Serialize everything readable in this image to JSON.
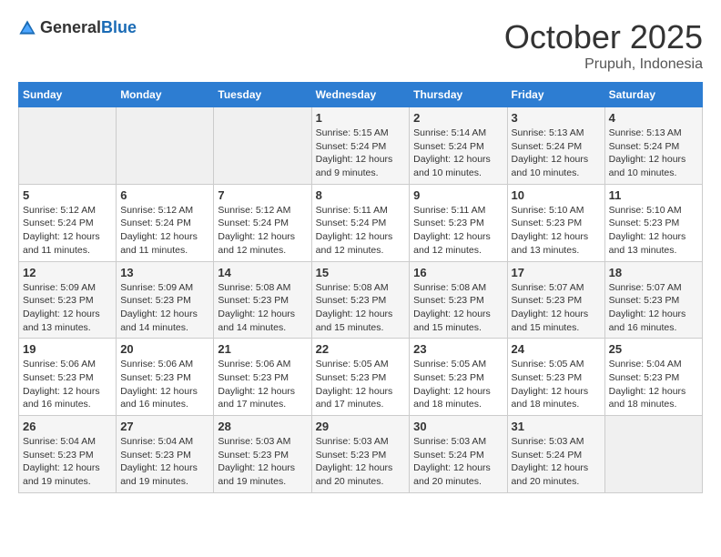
{
  "logo": {
    "text_general": "General",
    "text_blue": "Blue"
  },
  "title": "October 2025",
  "location": "Prupuh, Indonesia",
  "weekdays": [
    "Sunday",
    "Monday",
    "Tuesday",
    "Wednesday",
    "Thursday",
    "Friday",
    "Saturday"
  ],
  "weeks": [
    [
      {
        "day": "",
        "info": ""
      },
      {
        "day": "",
        "info": ""
      },
      {
        "day": "",
        "info": ""
      },
      {
        "day": "1",
        "info": "Sunrise: 5:15 AM\nSunset: 5:24 PM\nDaylight: 12 hours\nand 9 minutes."
      },
      {
        "day": "2",
        "info": "Sunrise: 5:14 AM\nSunset: 5:24 PM\nDaylight: 12 hours\nand 10 minutes."
      },
      {
        "day": "3",
        "info": "Sunrise: 5:13 AM\nSunset: 5:24 PM\nDaylight: 12 hours\nand 10 minutes."
      },
      {
        "day": "4",
        "info": "Sunrise: 5:13 AM\nSunset: 5:24 PM\nDaylight: 12 hours\nand 10 minutes."
      }
    ],
    [
      {
        "day": "5",
        "info": "Sunrise: 5:12 AM\nSunset: 5:24 PM\nDaylight: 12 hours\nand 11 minutes."
      },
      {
        "day": "6",
        "info": "Sunrise: 5:12 AM\nSunset: 5:24 PM\nDaylight: 12 hours\nand 11 minutes."
      },
      {
        "day": "7",
        "info": "Sunrise: 5:12 AM\nSunset: 5:24 PM\nDaylight: 12 hours\nand 12 minutes."
      },
      {
        "day": "8",
        "info": "Sunrise: 5:11 AM\nSunset: 5:24 PM\nDaylight: 12 hours\nand 12 minutes."
      },
      {
        "day": "9",
        "info": "Sunrise: 5:11 AM\nSunset: 5:23 PM\nDaylight: 12 hours\nand 12 minutes."
      },
      {
        "day": "10",
        "info": "Sunrise: 5:10 AM\nSunset: 5:23 PM\nDaylight: 12 hours\nand 13 minutes."
      },
      {
        "day": "11",
        "info": "Sunrise: 5:10 AM\nSunset: 5:23 PM\nDaylight: 12 hours\nand 13 minutes."
      }
    ],
    [
      {
        "day": "12",
        "info": "Sunrise: 5:09 AM\nSunset: 5:23 PM\nDaylight: 12 hours\nand 13 minutes."
      },
      {
        "day": "13",
        "info": "Sunrise: 5:09 AM\nSunset: 5:23 PM\nDaylight: 12 hours\nand 14 minutes."
      },
      {
        "day": "14",
        "info": "Sunrise: 5:08 AM\nSunset: 5:23 PM\nDaylight: 12 hours\nand 14 minutes."
      },
      {
        "day": "15",
        "info": "Sunrise: 5:08 AM\nSunset: 5:23 PM\nDaylight: 12 hours\nand 15 minutes."
      },
      {
        "day": "16",
        "info": "Sunrise: 5:08 AM\nSunset: 5:23 PM\nDaylight: 12 hours\nand 15 minutes."
      },
      {
        "day": "17",
        "info": "Sunrise: 5:07 AM\nSunset: 5:23 PM\nDaylight: 12 hours\nand 15 minutes."
      },
      {
        "day": "18",
        "info": "Sunrise: 5:07 AM\nSunset: 5:23 PM\nDaylight: 12 hours\nand 16 minutes."
      }
    ],
    [
      {
        "day": "19",
        "info": "Sunrise: 5:06 AM\nSunset: 5:23 PM\nDaylight: 12 hours\nand 16 minutes."
      },
      {
        "day": "20",
        "info": "Sunrise: 5:06 AM\nSunset: 5:23 PM\nDaylight: 12 hours\nand 16 minutes."
      },
      {
        "day": "21",
        "info": "Sunrise: 5:06 AM\nSunset: 5:23 PM\nDaylight: 12 hours\nand 17 minutes."
      },
      {
        "day": "22",
        "info": "Sunrise: 5:05 AM\nSunset: 5:23 PM\nDaylight: 12 hours\nand 17 minutes."
      },
      {
        "day": "23",
        "info": "Sunrise: 5:05 AM\nSunset: 5:23 PM\nDaylight: 12 hours\nand 18 minutes."
      },
      {
        "day": "24",
        "info": "Sunrise: 5:05 AM\nSunset: 5:23 PM\nDaylight: 12 hours\nand 18 minutes."
      },
      {
        "day": "25",
        "info": "Sunrise: 5:04 AM\nSunset: 5:23 PM\nDaylight: 12 hours\nand 18 minutes."
      }
    ],
    [
      {
        "day": "26",
        "info": "Sunrise: 5:04 AM\nSunset: 5:23 PM\nDaylight: 12 hours\nand 19 minutes."
      },
      {
        "day": "27",
        "info": "Sunrise: 5:04 AM\nSunset: 5:23 PM\nDaylight: 12 hours\nand 19 minutes."
      },
      {
        "day": "28",
        "info": "Sunrise: 5:03 AM\nSunset: 5:23 PM\nDaylight: 12 hours\nand 19 minutes."
      },
      {
        "day": "29",
        "info": "Sunrise: 5:03 AM\nSunset: 5:23 PM\nDaylight: 12 hours\nand 20 minutes."
      },
      {
        "day": "30",
        "info": "Sunrise: 5:03 AM\nSunset: 5:24 PM\nDaylight: 12 hours\nand 20 minutes."
      },
      {
        "day": "31",
        "info": "Sunrise: 5:03 AM\nSunset: 5:24 PM\nDaylight: 12 hours\nand 20 minutes."
      },
      {
        "day": "",
        "info": ""
      }
    ]
  ]
}
